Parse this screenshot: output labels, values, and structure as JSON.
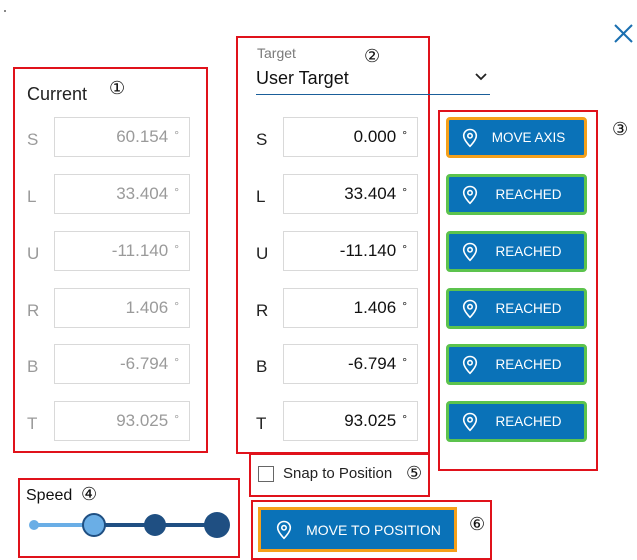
{
  "current": {
    "title": "Current",
    "axes": [
      {
        "letter": "S",
        "value": "60.154",
        "unit": "°"
      },
      {
        "letter": "L",
        "value": "33.404",
        "unit": "°"
      },
      {
        "letter": "U",
        "value": "-11.140",
        "unit": "°"
      },
      {
        "letter": "R",
        "value": "1.406",
        "unit": "°"
      },
      {
        "letter": "B",
        "value": "-6.794",
        "unit": "°"
      },
      {
        "letter": "T",
        "value": "93.025",
        "unit": "°"
      }
    ]
  },
  "target": {
    "label": "Target",
    "selected": "User Target",
    "axes": [
      {
        "letter": "S",
        "value": "0.000",
        "unit": "°"
      },
      {
        "letter": "L",
        "value": "33.404",
        "unit": "°"
      },
      {
        "letter": "U",
        "value": "-11.140",
        "unit": "°"
      },
      {
        "letter": "R",
        "value": "1.406",
        "unit": "°"
      },
      {
        "letter": "B",
        "value": "-6.794",
        "unit": "°"
      },
      {
        "letter": "T",
        "value": "93.025",
        "unit": "°"
      }
    ]
  },
  "axis_buttons": [
    {
      "label": "MOVE AXIS",
      "state": "pending"
    },
    {
      "label": "REACHED",
      "state": "reached"
    },
    {
      "label": "REACHED",
      "state": "reached"
    },
    {
      "label": "REACHED",
      "state": "reached"
    },
    {
      "label": "REACHED",
      "state": "reached"
    },
    {
      "label": "REACHED",
      "state": "reached"
    }
  ],
  "snap": {
    "label": "Snap to Position",
    "checked": false
  },
  "speed": {
    "label": "Speed",
    "levels": 4,
    "selected_level": 2
  },
  "move_to_position": {
    "label": "MOVE TO POSITION"
  },
  "annotations": [
    "①",
    "②",
    "③",
    "④",
    "⑤",
    "⑥"
  ],
  "colors": {
    "primary": "#0a72b8",
    "reached_border": "#5cc34d",
    "active_border": "#f5a01a",
    "annotation_box": "#e0121b",
    "slider": "#1f4f82"
  },
  "icons": {
    "close": "close-icon",
    "pin": "location-pin-icon",
    "dropdown": "chevron-down-icon"
  }
}
